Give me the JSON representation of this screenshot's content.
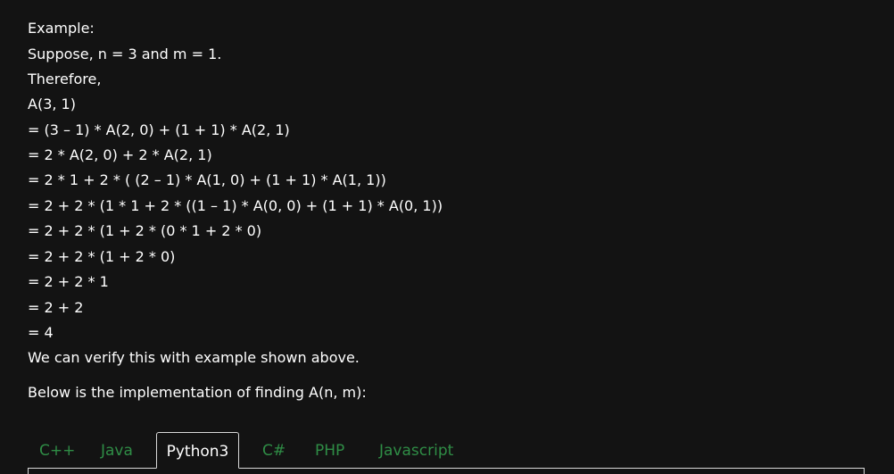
{
  "article": {
    "lines": [
      "Example:",
      "Suppose, n = 3 and m = 1.",
      "Therefore,",
      "A(3, 1)",
      "= (3 – 1) * A(2, 0) + (1 + 1) * A(2, 1)",
      "= 2 * A(2, 0) + 2 * A(2, 1)",
      "= 2 * 1 + 2 * ( (2 – 1) * A(1, 0) + (1 + 1) * A(1, 1))",
      "= 2 + 2 * (1 * 1 + 2 * ((1 – 1) * A(0, 0) + (1 + 1) * A(0, 1))",
      "= 2 + 2 * (1 + 2 * (0 * 1 + 2 * 0)",
      "= 2 + 2 * (1 + 2 * 0)",
      "= 2 + 2 * 1",
      "= 2 + 2",
      "= 4",
      "We can verify this with example shown above.",
      "Below is the implementation of finding A(n, m):"
    ]
  },
  "tabs": {
    "active": "Python3",
    "items": [
      {
        "label": "C++"
      },
      {
        "label": "Java"
      },
      {
        "label": "Python3"
      },
      {
        "label": "C#"
      },
      {
        "label": "PHP"
      },
      {
        "label": "Javascript"
      }
    ]
  },
  "colors": {
    "background": "#131313",
    "text": "#ffffff",
    "tab_inactive": "#2f8d46",
    "border": "#d9d9d9"
  }
}
